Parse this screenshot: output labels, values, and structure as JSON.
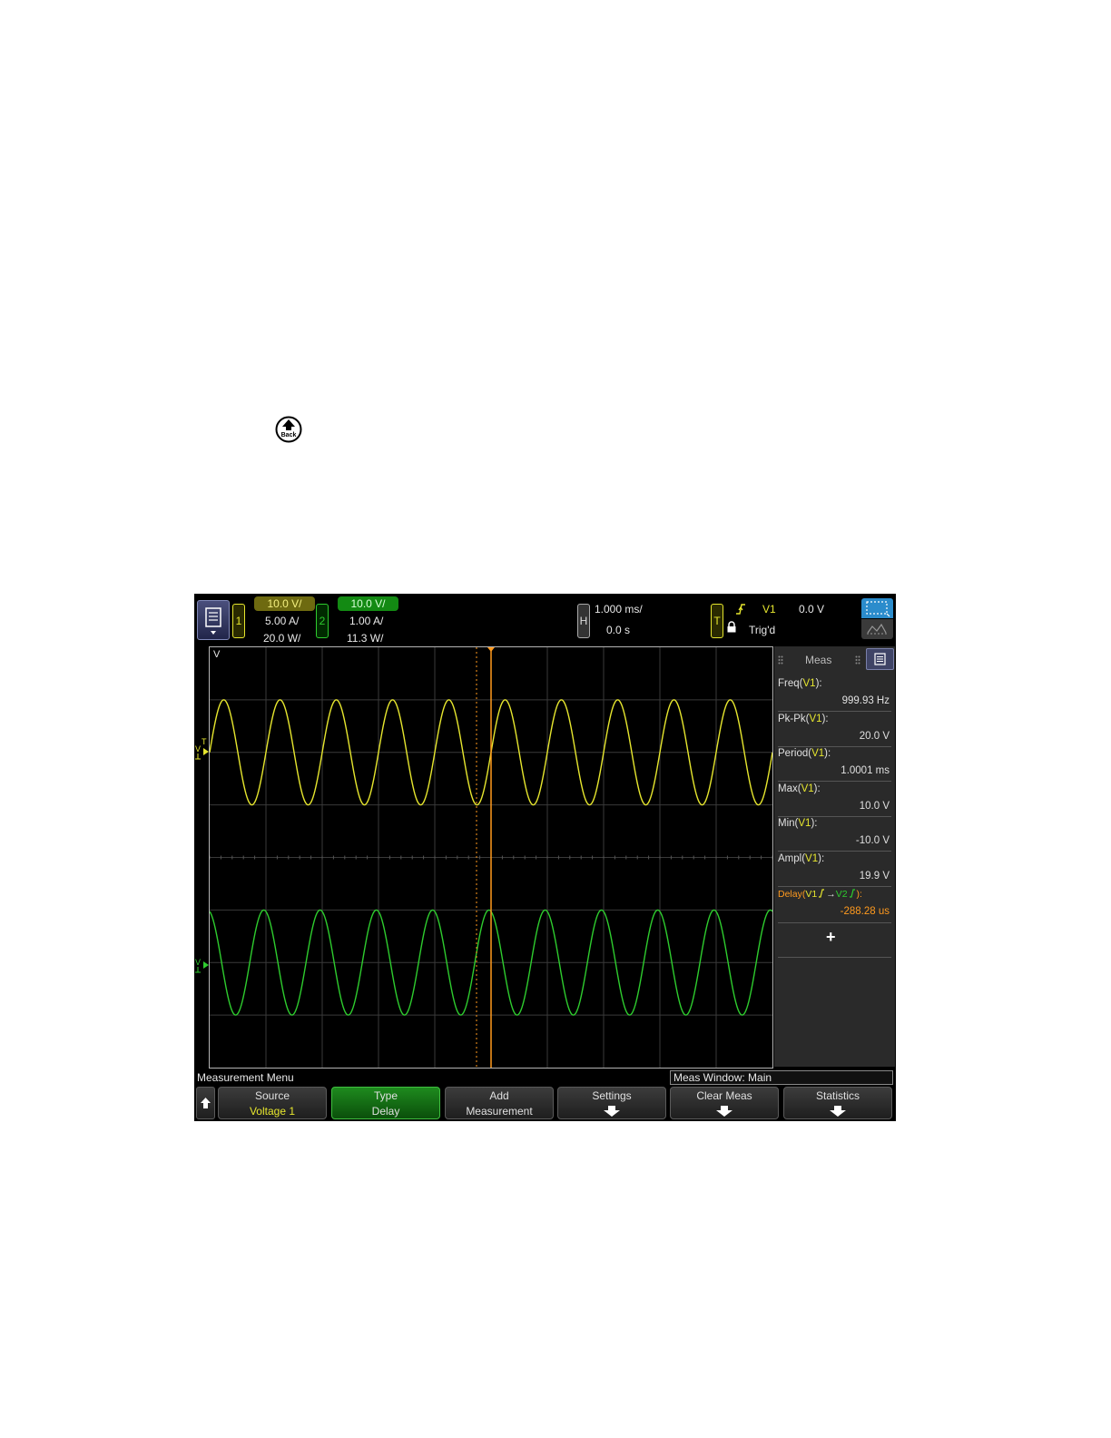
{
  "page": {
    "back_icon_label": "Back"
  },
  "header": {
    "ch1": {
      "number": "1",
      "vscale": "10.0 V/",
      "iscale": "5.00 A/",
      "pscale": "20.0 W/",
      "color": "#e6e62e"
    },
    "ch2": {
      "number": "2",
      "vscale": "10.0 V/",
      "iscale": "1.00 A/",
      "pscale": "11.3 W/",
      "color": "#2ecc2e"
    },
    "horizontal": {
      "badge": "H",
      "timebase": "1.000 ms/",
      "delay": "0.0 s"
    },
    "trigger": {
      "badge": "T",
      "source": "V1",
      "level": "0.0 V",
      "status": "Trig'd"
    }
  },
  "plot": {
    "units_label": "V",
    "trigger_marker": "T"
  },
  "meas_panel": {
    "title": "Meas",
    "items": [
      {
        "name": "Freq(",
        "src": "V1",
        "tail": "):",
        "value": "999.93 Hz"
      },
      {
        "name": "Pk-Pk(",
        "src": "V1",
        "tail": "):",
        "value": "20.0 V"
      },
      {
        "name": "Period(",
        "src": "V1",
        "tail": "):",
        "value": "1.0001 ms"
      },
      {
        "name": "Max(",
        "src": "V1",
        "tail": "):",
        "value": "10.0 V"
      },
      {
        "name": "Min(",
        "src": "V1",
        "tail": "):",
        "value": "-10.0 V"
      },
      {
        "name": "Ampl(",
        "src": "V1",
        "tail": "):",
        "value": "19.9 V"
      }
    ],
    "delay": {
      "name": "Delay(",
      "src1": "V1",
      "arrow": "→",
      "src2": "V2",
      "tail": "):",
      "value": "-288.28 us"
    },
    "add_label": "+"
  },
  "menu": {
    "title": "Measurement Menu",
    "window": "Meas Window: Main",
    "softkeys": [
      {
        "line1": "Source",
        "line2": "Voltage 1"
      },
      {
        "line1": "Type",
        "line2": "Delay"
      },
      {
        "line1": "Add",
        "line2": "Measurement"
      },
      {
        "line1": "Settings",
        "line2": ""
      },
      {
        "line1": "Clear Meas",
        "line2": ""
      },
      {
        "line1": "Statistics",
        "line2": ""
      }
    ]
  },
  "colors": {
    "ch1": "#e6e62e",
    "ch2": "#2ecc2e",
    "delay": "#ff9a1e",
    "grid": "#3a3a3a"
  }
}
